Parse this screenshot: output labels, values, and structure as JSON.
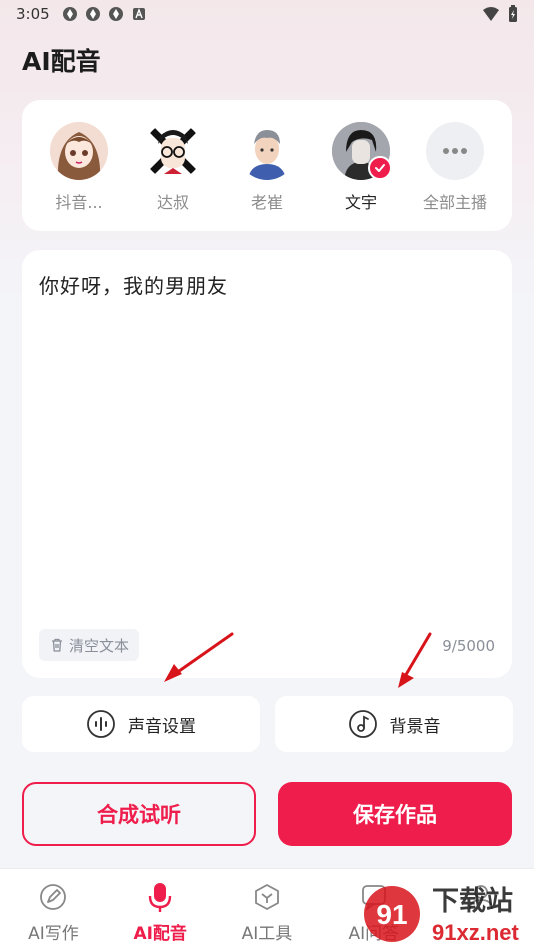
{
  "status_bar": {
    "time": "3:05"
  },
  "page": {
    "title": "AI配音"
  },
  "voices": [
    {
      "name": "抖音...",
      "selected": false,
      "avatar": "anime-girl-avatar"
    },
    {
      "name": "达叔",
      "selected": false,
      "avatar": "glasses-man-avatar"
    },
    {
      "name": "老崔",
      "selected": false,
      "avatar": "grey-hair-man-avatar"
    },
    {
      "name": "文宇",
      "selected": true,
      "avatar": "dark-hair-boy-avatar"
    },
    {
      "name": "全部主播",
      "selected": false,
      "avatar": "more-dots-icon"
    }
  ],
  "editor": {
    "text": "你好呀，我的男朋友",
    "clear_label": "清空文本",
    "counter": "9/5000"
  },
  "options": {
    "voice_settings_label": "声音设置",
    "bgm_label": "背景音"
  },
  "actions": {
    "preview_label": "合成试听",
    "save_label": "保存作品"
  },
  "tabs": [
    {
      "label": "AI写作",
      "icon": "pen-icon",
      "active": false
    },
    {
      "label": "AI配音",
      "icon": "microphone-icon",
      "active": true
    },
    {
      "label": "AI工具",
      "icon": "cube-icon",
      "active": false
    },
    {
      "label": "AI问答",
      "icon": "chat-icon",
      "active": false
    },
    {
      "label": "",
      "icon": "user-icon",
      "active": false
    }
  ],
  "watermark": {
    "site": "下载站",
    "url": "91xz.net",
    "logo_text": "91"
  },
  "colors": {
    "accent": "#ef1d4b",
    "background": "#f4f5f9"
  }
}
